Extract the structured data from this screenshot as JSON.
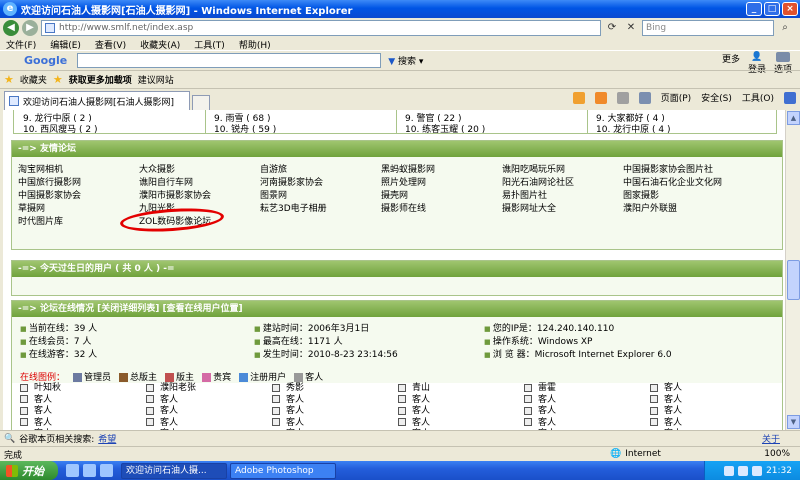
{
  "window": {
    "title": "欢迎访问石油人摄影网[石油人摄影网] - Windows Internet Explorer"
  },
  "address": {
    "url": "http://www.smlf.net/index.asp",
    "search_placeholder": "Bing"
  },
  "menu": [
    "文件(F)",
    "编辑(E)",
    "查看(V)",
    "收藏夹(A)",
    "工具(T)",
    "帮助(H)"
  ],
  "googlebar": {
    "logo": "Google",
    "search_label": "搜索",
    "more": "更多",
    "login": "登录",
    "options": "选项"
  },
  "favorites": {
    "label": "收藏夹",
    "addons": "获取更多加载项",
    "suggest": "建议网站"
  },
  "tab": {
    "title": "欢迎访问石油人摄影网[石油人摄影网]"
  },
  "commands": [
    "页面(P)",
    "安全(S)",
    "工具(O)"
  ],
  "ranking": {
    "rows": [
      [
        "9.   龙行中原 ( 2 )",
        "9.   雨雪 ( 68 )",
        "9.   警官 ( 22 )",
        "9.   大家都好 ( 4 )"
      ],
      [
        "10.  西风瘦马 ( 2 )",
        "10.  锐舟 ( 59 )",
        "10.  练客玉耀 ( 20 )",
        "10.  龙行中原 ( 4 )"
      ]
    ]
  },
  "friends": {
    "header": "-=> 友情论坛",
    "links": [
      "淘宝网相机",
      "大众摄影",
      "自游旅",
      "黑蚂蚁摄影网",
      "谯阳吃喝玩乐网",
      "中国摄影家协会图片社",
      "中国旅行摄影网",
      "谯阳自行车网",
      "河南摄影家协会",
      "照片处理网",
      "阳光石油网论社区",
      "中国石油石化企业文化网",
      "中国摄影家协会",
      "濮阳市摄影家协会",
      "图景网",
      "摄壳网",
      "易扑图片社",
      "图家摄影",
      "草摄网",
      "九阳光影",
      "耘艺3D电子相册",
      "摄影师在线",
      "摄影网址大全",
      "濮阳户外联盟",
      "时代图片库",
      "ZOL数码影像论坛",
      "",
      "",
      "",
      ""
    ]
  },
  "birthday": {
    "header": "-=> 今天过生日的用户 ( 共 0 人 ) -="
  },
  "online": {
    "header": "-=> 论坛在线情况 [关闭详细列表] [查看在线用户位置]",
    "stats": [
      "当前在线：39 人",
      "建站时间：2006年3月1日",
      "您的IP是：124.240.140.110",
      "在线会员：7 人",
      "最高在线：1171 人",
      "操作系统：Windows XP",
      "在线游客：32 人",
      "发生时间：2010-8-23 23:14:56",
      "浏 览 器：Microsoft Internet Explorer 6.0"
    ],
    "legend_label": "在线图例：",
    "legend": [
      "管理员",
      "总版主",
      "版主",
      "贵宾",
      "注册用户",
      "客人"
    ],
    "users": [
      "叶知秋",
      "濮阳老张",
      "秀影",
      "青山",
      "雷霍",
      "客人",
      "客人",
      "客人",
      "客人",
      "客人",
      "客人",
      "客人",
      "客人",
      "客人",
      "客人",
      "客人",
      "客人",
      "客人",
      "客人",
      "客人",
      "客人",
      "客人",
      "客人",
      "客人",
      "客人",
      "客人",
      "客人",
      "客人",
      "客人",
      "客人"
    ]
  },
  "helpbar": {
    "label": "谷歌本页相关搜索:",
    "link": "希望",
    "close": "关于"
  },
  "status": {
    "text": "完成",
    "zone": "Internet",
    "zoom": "100%"
  },
  "taskbar": {
    "start": "开始",
    "tasks": [
      "欢迎访问石油人摄...",
      "Adobe Photoshop"
    ],
    "clock": "21:32"
  }
}
